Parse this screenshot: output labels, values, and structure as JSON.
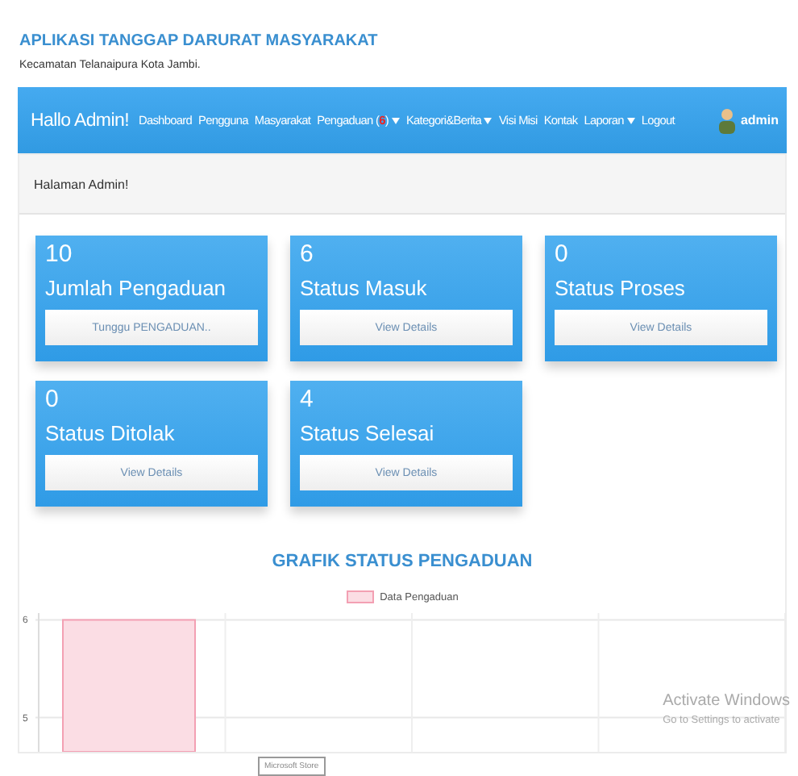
{
  "header": {
    "title": "APLIKASI TANGGAP DARURAT MASYARAKAT",
    "subtitle": "Kecamatan Telanaipura Kota Jambi."
  },
  "navbar": {
    "brand": "Hallo Admin!",
    "items": [
      {
        "label": "Dashboard",
        "dropdown": false
      },
      {
        "label": "Pengguna",
        "dropdown": false
      },
      {
        "label": "Masyarakat",
        "dropdown": false
      },
      {
        "label": "Pengaduan (",
        "badge": "6",
        "suffix": ")",
        "dropdown": true
      },
      {
        "label": "Kategori&Berita",
        "dropdown": true
      },
      {
        "label": "Visi Misi",
        "dropdown": false
      },
      {
        "label": "Kontak",
        "dropdown": false
      },
      {
        "label": "Laporan",
        "dropdown": true
      },
      {
        "label": "Logout",
        "dropdown": false
      }
    ],
    "user": "admin"
  },
  "panel_heading": "Halaman Admin!",
  "cards": [
    {
      "count": "10",
      "title": "Jumlah Pengaduan",
      "button": "Tunggu PENGADUAN.."
    },
    {
      "count": "6",
      "title": "Status Masuk",
      "button": "View Details"
    },
    {
      "count": "0",
      "title": "Status Proses",
      "button": "View Details"
    },
    {
      "count": "0",
      "title": "Status Ditolak",
      "button": "View Details"
    },
    {
      "count": "4",
      "title": "Status Selesai",
      "button": "View Details"
    }
  ],
  "chart": {
    "title": "GRAFIK STATUS PENGADUAN",
    "chart_data": {
      "type": "bar",
      "series": [
        {
          "name": "Data Pengaduan",
          "color": "#fbdde4",
          "values": [
            6,
            null,
            null,
            null
          ]
        }
      ],
      "yticks": [
        5,
        6
      ],
      "ylim": [
        4.65,
        6.07
      ]
    }
  },
  "overlays": {
    "tooltip": "Microsoft Store",
    "activation_title": "Activate Windows",
    "activation_text": "Go to Settings to activate"
  }
}
